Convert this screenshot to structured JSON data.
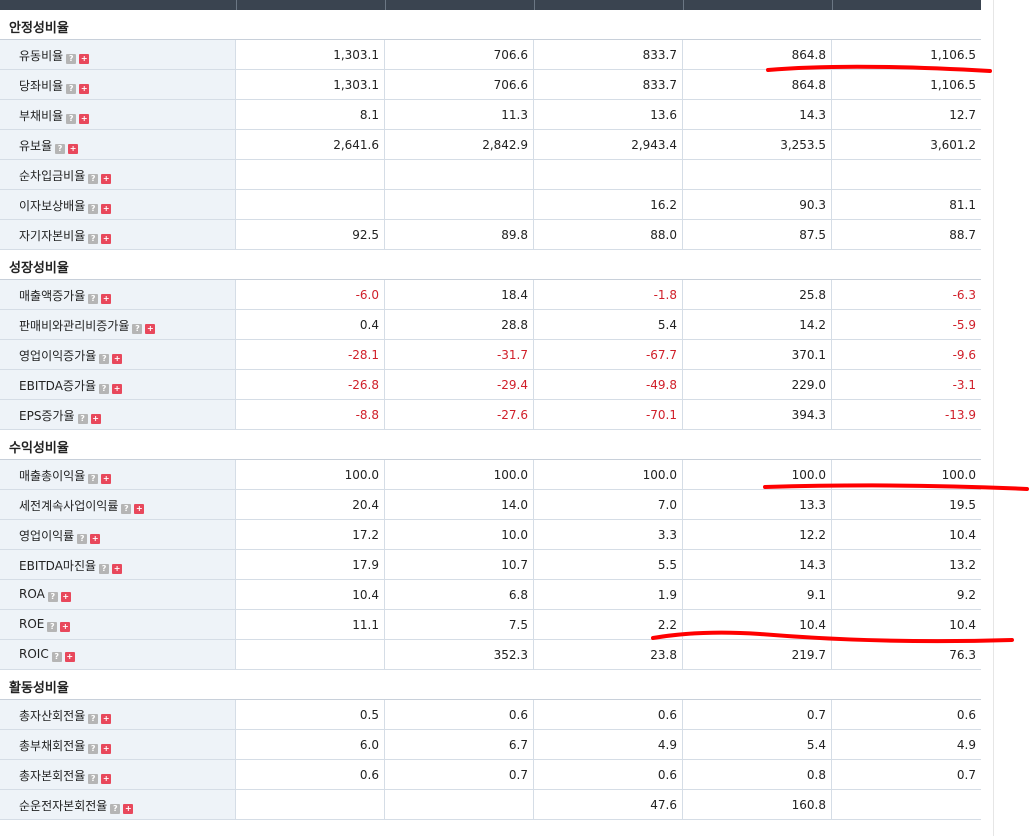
{
  "sections": [
    {
      "title": "안정성비율",
      "rows": [
        {
          "label": "유동비율",
          "values": [
            "1,303.1",
            "706.6",
            "833.7",
            "864.8",
            "1,106.5"
          ]
        },
        {
          "label": "당좌비율",
          "values": [
            "1,303.1",
            "706.6",
            "833.7",
            "864.8",
            "1,106.5"
          ]
        },
        {
          "label": "부채비율",
          "values": [
            "8.1",
            "11.3",
            "13.6",
            "14.3",
            "12.7"
          ]
        },
        {
          "label": "유보율",
          "values": [
            "2,641.6",
            "2,842.9",
            "2,943.4",
            "3,253.5",
            "3,601.2"
          ]
        },
        {
          "label": "순차입금비율",
          "values": [
            "",
            "",
            "",
            "",
            ""
          ]
        },
        {
          "label": "이자보상배율",
          "values": [
            "",
            "",
            "16.2",
            "90.3",
            "81.1"
          ]
        },
        {
          "label": "자기자본비율",
          "values": [
            "92.5",
            "89.8",
            "88.0",
            "87.5",
            "88.7"
          ]
        }
      ]
    },
    {
      "title": "성장성비율",
      "rows": [
        {
          "label": "매출액증가율",
          "values": [
            "-6.0",
            "18.4",
            "-1.8",
            "25.8",
            "-6.3"
          ]
        },
        {
          "label": "판매비와관리비증가율",
          "values": [
            "0.4",
            "28.8",
            "5.4",
            "14.2",
            "-5.9"
          ]
        },
        {
          "label": "영업이익증가율",
          "values": [
            "-28.1",
            "-31.7",
            "-67.7",
            "370.1",
            "-9.6"
          ]
        },
        {
          "label": "EBITDA증가율",
          "values": [
            "-26.8",
            "-29.4",
            "-49.8",
            "229.0",
            "-3.1"
          ]
        },
        {
          "label": "EPS증가율",
          "values": [
            "-8.8",
            "-27.6",
            "-70.1",
            "394.3",
            "-13.9"
          ]
        }
      ]
    },
    {
      "title": "수익성비율",
      "rows": [
        {
          "label": "매출총이익율",
          "values": [
            "100.0",
            "100.0",
            "100.0",
            "100.0",
            "100.0"
          ]
        },
        {
          "label": "세전계속사업이익률",
          "values": [
            "20.4",
            "14.0",
            "7.0",
            "13.3",
            "19.5"
          ]
        },
        {
          "label": "영업이익률",
          "values": [
            "17.2",
            "10.0",
            "3.3",
            "12.2",
            "10.4"
          ]
        },
        {
          "label": "EBITDA마진율",
          "values": [
            "17.9",
            "10.7",
            "5.5",
            "14.3",
            "13.2"
          ]
        },
        {
          "label": "ROA",
          "values": [
            "10.4",
            "6.8",
            "1.9",
            "9.1",
            "9.2"
          ]
        },
        {
          "label": "ROE",
          "values": [
            "11.1",
            "7.5",
            "2.2",
            "10.4",
            "10.4"
          ]
        },
        {
          "label": "ROIC",
          "values": [
            "",
            "352.3",
            "23.8",
            "219.7",
            "76.3"
          ]
        }
      ]
    },
    {
      "title": "활동성비율",
      "rows": [
        {
          "label": "총자산회전율",
          "values": [
            "0.5",
            "0.6",
            "0.6",
            "0.7",
            "0.6"
          ]
        },
        {
          "label": "총부채회전율",
          "values": [
            "6.0",
            "6.7",
            "4.9",
            "5.4",
            "4.9"
          ]
        },
        {
          "label": "총자본회전율",
          "values": [
            "0.6",
            "0.7",
            "0.6",
            "0.8",
            "0.7"
          ]
        },
        {
          "label": "순운전자본회전율",
          "values": [
            "",
            "",
            "47.6",
            "160.8",
            ""
          ]
        }
      ]
    }
  ],
  "icons": {
    "help_glyph": "?",
    "expand_glyph": "+"
  },
  "colors": {
    "negative": "#d0202a",
    "annotation": "#ff0000",
    "header_bar": "#3a4450",
    "label_bg": "#eef3f8"
  }
}
